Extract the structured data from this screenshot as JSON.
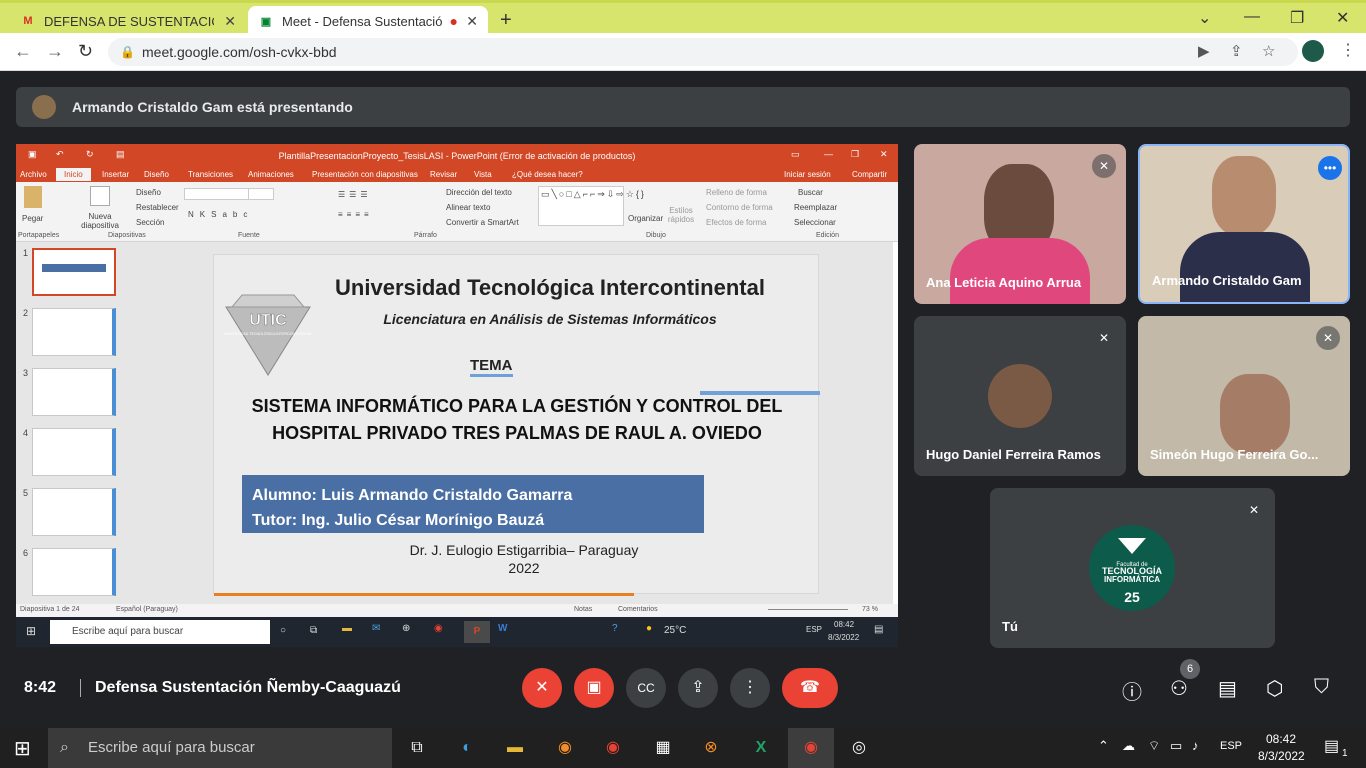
{
  "browser": {
    "tabs": [
      {
        "title": "DEFENSA DE SUSTENTACIÓN LIC",
        "icon": "gmail-icon"
      },
      {
        "title": "Meet - Defensa Sustentación",
        "icon": "meet-icon"
      }
    ],
    "url": "meet.google.com/osh-cvkx-bbd"
  },
  "meet": {
    "presenting_banner": "Armando Cristaldo Gam está presentando",
    "participants": [
      {
        "name": "Ana Leticia Aquino Arrua"
      },
      {
        "name": "Armando Cristaldo Gam"
      },
      {
        "name": "Hugo Daniel Ferreira Ramos"
      },
      {
        "name": "Simeón Hugo Ferreira Go..."
      },
      {
        "name": "Tú"
      }
    ],
    "self_logo": {
      "line1": "Facultad de",
      "line2": "TECNOLOGÍA",
      "line3": "INFORMÁTICA",
      "badge": "25"
    },
    "time": "8:42",
    "meeting_name": "Defensa Sustentación Ñemby-Caaguazú",
    "people_count": "6"
  },
  "ppt": {
    "window_title": "PlantillaPresentacionProyecto_TesisLASI - PowerPoint (Error de activación de productos)",
    "ribbon_tabs": [
      "Archivo",
      "Inicio",
      "Insertar",
      "Diseño",
      "Transiciones",
      "Animaciones",
      "Presentación con diapositivas",
      "Revisar",
      "Vista",
      "¿Qué desea hacer?"
    ],
    "ribbon_right": [
      "Iniciar sesión",
      "Compartir"
    ],
    "groups": [
      "Portapapeles",
      "Diapositivas",
      "Fuente",
      "Párrafo",
      "Dibujo",
      "Edición"
    ],
    "ribbon_buttons": {
      "pegar": "Pegar",
      "nueva": "Nueva diapositiva",
      "diseno": "Diseño",
      "restablecer": "Restablecer",
      "seccion": "Sección",
      "direccion": "Dirección del texto",
      "alinear": "Alinear texto",
      "smartart": "Convertir a SmartArt",
      "organizar": "Organizar",
      "estilos": "Estilos rápidos",
      "relleno": "Relleno de forma",
      "contorno": "Contorno de forma",
      "efectos": "Efectos de forma",
      "buscar": "Buscar",
      "reemplazar": "Reemplazar",
      "seleccionar": "Seleccionar"
    },
    "thumb_numbers": [
      "1",
      "2",
      "3",
      "4",
      "5",
      "6"
    ],
    "slide": {
      "logo_text": "UTIC",
      "logo_sub": "UNIVERSIDAD TECNOLÓGICA INTERCONTINENTAL",
      "university": "Universidad Tecnológica Intercontinental",
      "career": "Licenciatura en Análisis de Sistemas Informáticos",
      "tema": "TEMA",
      "title_line1": "SISTEMA INFORMÁTICO PARA LA GESTIÓN Y CONTROL DEL",
      "title_line2": "HOSPITAL PRIVADO TRES PALMAS DE RAUL A. OVIEDO",
      "alumno": "Alumno: Luis Armando Cristaldo Gamarra",
      "tutor": "Tutor: Ing. Julio César Morínigo Bauzá",
      "place": "Dr. J. Eulogio Estigarribia– Paraguay",
      "year": "2022"
    },
    "status": {
      "slide_count": "Diapositiva 1 de 24",
      "language": "Español (Paraguay)",
      "notes": "Notas",
      "comments": "Comentarios",
      "zoom": "73 %"
    },
    "inner_taskbar": {
      "search": "Escribe aquí para buscar",
      "weather": "25°C",
      "lang": "ESP",
      "time": "08:42",
      "date": "8/3/2022"
    }
  },
  "taskbar": {
    "search_placeholder": "Escribe aquí para buscar",
    "lang": "ESP",
    "time": "08:42",
    "date": "8/3/2022",
    "notifications": "1"
  },
  "colors": {
    "tabbar": "#d8e56c",
    "ppt_accent": "#d24726",
    "meet_bg": "#202124",
    "end_call": "#ea4335",
    "active_speaker": "#8ab4f8"
  }
}
